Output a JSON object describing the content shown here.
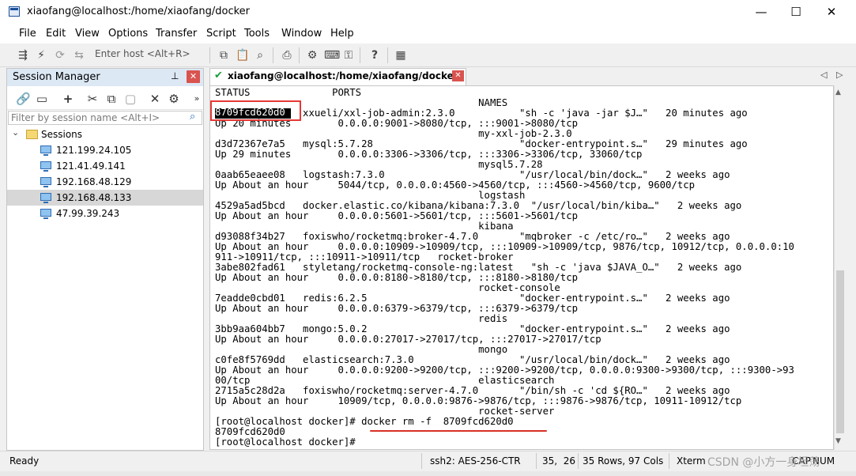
{
  "window": {
    "title": "xiaofang@localhost:/home/xiaofang/docker",
    "minimize": "—",
    "maximize": "☐",
    "close": "✕"
  },
  "menu": [
    "File",
    "Edit",
    "View",
    "Options",
    "Transfer",
    "Script",
    "Tools",
    "Window",
    "Help"
  ],
  "toolbar": {
    "quick_connect_placeholder": "Enter host <Alt+R>",
    "icons": [
      "connect-icon",
      "lightning-icon",
      "reconnect-icon",
      "copy-icon",
      "paste-icon",
      "find-icon",
      "print-icon",
      "settings-icon",
      "keymap-icon",
      "key-icon",
      "help-icon",
      "sftp-icon"
    ]
  },
  "session_manager": {
    "title": "Session Manager",
    "pin": "⊥",
    "close": "✕",
    "filter_placeholder": "Filter by session name <Alt+I>",
    "root_label": "Sessions",
    "sessions": [
      "121.199.24.105",
      "121.41.49.141",
      "192.168.48.129",
      "192.168.48.133",
      "47.99.39.243"
    ],
    "selected_index": 3
  },
  "tab": {
    "label": "xiaofang@localhost:/home/xiaofang/docker",
    "close": "✕"
  },
  "terminal": {
    "lines": [
      "STATUS              PORTS",
      "                                             NAMES",
      "8709fcd620d0   xxueli/xxl-job-admin:2.3.0           \"sh -c 'java -jar $J…\"   20 minutes ago",
      "Up 20 minutes        0.0.0.0:9001->8080/tcp, :::9001->8080/tcp",
      "                                             my-xxl-job-2.3.0",
      "d3d72367e7a5   mysql:5.7.28                         \"docker-entrypoint.s…\"   29 minutes ago",
      "Up 29 minutes        0.0.0.0:3306->3306/tcp, :::3306->3306/tcp, 33060/tcp",
      "                                             mysql5.7.28",
      "0aab65eaee08   logstash:7.3.0                       \"/usr/local/bin/dock…\"   2 weeks ago",
      "Up About an hour     5044/tcp, 0.0.0.0:4560->4560/tcp, :::4560->4560/tcp, 9600/tcp",
      "                                             logstash",
      "4529a5ad5bcd   docker.elastic.co/kibana/kibana:7.3.0  \"/usr/local/bin/kiba…\"   2 weeks ago",
      "Up About an hour     0.0.0.0:5601->5601/tcp, :::5601->5601/tcp",
      "                                             kibana",
      "d93088f34b27   foxiswho/rocketmq:broker-4.7.0       \"mqbroker -c /etc/ro…\"   2 weeks ago",
      "Up About an hour     0.0.0.0:10909->10909/tcp, :::10909->10909/tcp, 9876/tcp, 10912/tcp, 0.0.0.0:10",
      "911->10911/tcp, :::10911->10911/tcp   rocket-broker",
      "3abe802fad61   styletang/rocketmq-console-ng:latest   \"sh -c 'java $JAVA_O…\"   2 weeks ago",
      "Up About an hour     0.0.0.0:8180->8180/tcp, :::8180->8180/tcp",
      "                                             rocket-console",
      "7eadde0cbd01   redis:6.2.5                          \"docker-entrypoint.s…\"   2 weeks ago",
      "Up About an hour     0.0.0.0:6379->6379/tcp, :::6379->6379/tcp",
      "                                             redis",
      "3bb9aa604bb7   mongo:5.0.2                          \"docker-entrypoint.s…\"   2 weeks ago",
      "Up About an hour     0.0.0.0:27017->27017/tcp, :::27017->27017/tcp",
      "                                             mongo",
      "c0fe8f5769dd   elasticsearch:7.3.0                  \"/usr/local/bin/dock…\"   2 weeks ago",
      "Up About an hour     0.0.0.0:9200->9200/tcp, :::9200->9200/tcp, 0.0.0.0:9300->9300/tcp, :::9300->93",
      "00/tcp                                       elasticsearch",
      "2715a5c28d2a   foxiswho/rocketmq:server-4.7.0       \"/bin/sh -c 'cd ${RO…\"   2 weeks ago",
      "Up About an hour     10909/tcp, 0.0.0.0:9876->9876/tcp, :::9876->9876/tcp, 10911-10912/tcp",
      "                                             rocket-server",
      "[root@localhost docker]# docker rm -f  8709fcd620d0",
      "8709fcd620d0",
      "[root@localhost docker]#"
    ],
    "highlighted_id": "8709fcd620d0"
  },
  "statusbar": {
    "ready": "Ready",
    "encryption": "ssh2: AES-256-CTR",
    "cursor": "35,  26",
    "size": "35 Rows, 97 Cols",
    "term": "Xterm",
    "caps": "CAP",
    "num": "NUM"
  },
  "watermark": "CSDN @小方一身坦荡",
  "colors": {
    "accent_red": "#e53935",
    "tab_check": "#1b9e3e",
    "selection": "#d7d7d7"
  }
}
